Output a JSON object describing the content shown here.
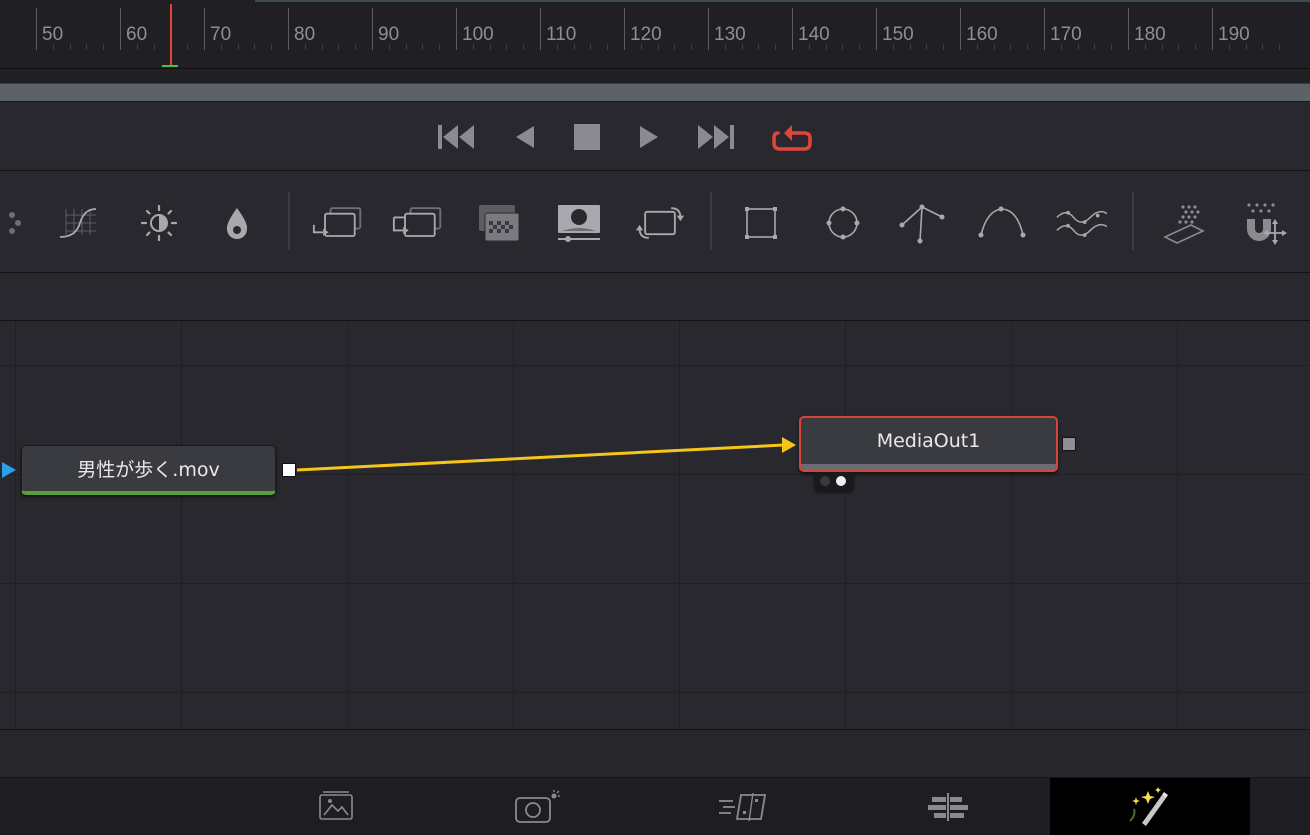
{
  "ruler": {
    "labels": [
      "50",
      "60",
      "70",
      "80",
      "90",
      "100",
      "110",
      "120",
      "130",
      "140",
      "150",
      "160",
      "170",
      "180",
      "190"
    ],
    "playhead_frame": 63,
    "playhead_color": "#e0453a"
  },
  "transport": {
    "buttons": [
      {
        "name": "go-to-start-button",
        "icon": "skip-to-start-icon"
      },
      {
        "name": "play-reverse-button",
        "icon": "play-reverse-icon"
      },
      {
        "name": "stop-button",
        "icon": "stop-icon"
      },
      {
        "name": "play-forward-button",
        "icon": "play-icon"
      },
      {
        "name": "go-to-end-button",
        "icon": "skip-to-end-icon"
      },
      {
        "name": "loop-button",
        "icon": "loop-icon",
        "active_color": "#e0453a"
      }
    ]
  },
  "toolbar": {
    "tools": [
      "particles-icon",
      "curves-icon",
      "brightness-contrast-icon",
      "color-corrector-icon",
      "merge-icon",
      "channel-booleans-icon",
      "matte-control-icon",
      "mask-paint-icon",
      "transform-icon",
      "rectangle-mask-icon",
      "ellipse-mask-icon",
      "polygon-mask-icon",
      "bspline-mask-icon",
      "wave-mask-icon",
      "pemitter-icon",
      "prender-icon"
    ]
  },
  "nodes": {
    "media_in": {
      "label": "男性が歩く.mov",
      "accent": "#5aa03a"
    },
    "media_out": {
      "label": "MediaOut1",
      "accent": "#d8443a"
    },
    "connection_color": "#f5c518"
  },
  "pagebar": {
    "tabs": [
      {
        "name": "page-tab-media",
        "icon": "media-page-icon"
      },
      {
        "name": "page-tab-cut",
        "icon": "cut-page-icon"
      },
      {
        "name": "page-tab-edit",
        "icon": "edit-page-icon"
      },
      {
        "name": "page-tab-fusion",
        "icon": "fusion-page-icon"
      },
      {
        "name": "page-tab-color",
        "icon": "color-page-icon",
        "active": true
      }
    ]
  }
}
